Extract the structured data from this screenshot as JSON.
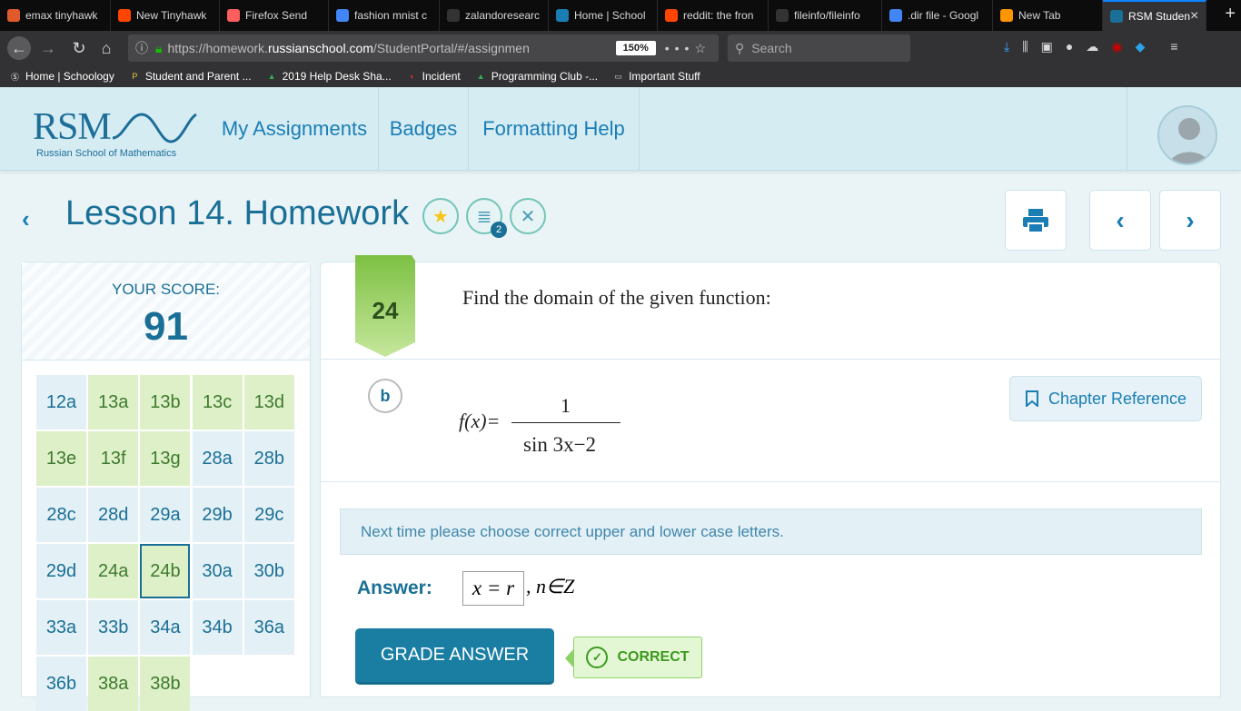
{
  "browser": {
    "tabs": [
      {
        "label": "emax tinyhawk",
        "icon": "bg-icon",
        "color": "#e05a2b"
      },
      {
        "label": "New Tinyhawk",
        "icon": "reddit-icon",
        "color": "#ff4500"
      },
      {
        "label": "Firefox Send",
        "icon": "firefox-send-icon",
        "color": "#ff5e5e"
      },
      {
        "label": "fashion mnist c",
        "icon": "google-icon",
        "color": "#4285f4"
      },
      {
        "label": "zalandoresearc",
        "icon": "github-icon",
        "color": "#333333"
      },
      {
        "label": "Home | School",
        "icon": "schoology-icon",
        "color": "#1a7eb5"
      },
      {
        "label": "reddit: the fron",
        "icon": "reddit-icon",
        "color": "#ff4500"
      },
      {
        "label": "fileinfo/fileinfo",
        "icon": "github-icon",
        "color": "#333333"
      },
      {
        "label": ".dir file - Googl",
        "icon": "google-icon",
        "color": "#4285f4"
      },
      {
        "label": "New Tab",
        "icon": "firefox-icon",
        "color": "#ff9500"
      },
      {
        "label": "RSM Studen",
        "icon": "rsm-icon",
        "color": "#1a6f96",
        "active": true
      }
    ],
    "url_prefix": "https://homework.",
    "url_domain": "russianschool.com",
    "url_path": "/StudentPortal/#/assignmen",
    "zoom": "150%",
    "search_placeholder": "Search",
    "bookmarks": [
      {
        "label": "Home | Schoology",
        "icon": "schoology-icon"
      },
      {
        "label": "Student and Parent ...",
        "icon": "parent-portal-icon"
      },
      {
        "label": "2019 Help Desk Sha...",
        "icon": "google-drive-icon"
      },
      {
        "label": "Incident",
        "icon": "incident-icon"
      },
      {
        "label": "Programming Club -...",
        "icon": "google-drive-icon"
      },
      {
        "label": "Important Stuff",
        "icon": "folder-icon"
      }
    ]
  },
  "site": {
    "logo_text": "RSM",
    "logo_sub": "Russian School of Mathematics",
    "nav": [
      "My Assignments",
      "Badges",
      "Formatting Help"
    ]
  },
  "lesson": {
    "title": "Lesson 14. Homework",
    "badge_count": "2"
  },
  "score": {
    "label": "YOUR SCORE:",
    "value": "91"
  },
  "problems": [
    {
      "label": "12a",
      "status": "blue"
    },
    {
      "label": "13a",
      "status": "green"
    },
    {
      "label": "13b",
      "status": "green"
    },
    {
      "label": "13c",
      "status": "green"
    },
    {
      "label": "13d",
      "status": "green"
    },
    {
      "label": "13e",
      "status": "green"
    },
    {
      "label": "13f",
      "status": "green"
    },
    {
      "label": "13g",
      "status": "green"
    },
    {
      "label": "28a",
      "status": "blue"
    },
    {
      "label": "28b",
      "status": "blue"
    },
    {
      "label": "28c",
      "status": "blue"
    },
    {
      "label": "28d",
      "status": "blue"
    },
    {
      "label": "29a",
      "status": "blue"
    },
    {
      "label": "29b",
      "status": "blue"
    },
    {
      "label": "29c",
      "status": "blue"
    },
    {
      "label": "29d",
      "status": "blue"
    },
    {
      "label": "24a",
      "status": "green"
    },
    {
      "label": "24b",
      "status": "green",
      "selected": true
    },
    {
      "label": "30a",
      "status": "blue"
    },
    {
      "label": "30b",
      "status": "blue"
    },
    {
      "label": "33a",
      "status": "blue"
    },
    {
      "label": "33b",
      "status": "blue"
    },
    {
      "label": "34a",
      "status": "blue"
    },
    {
      "label": "34b",
      "status": "blue"
    },
    {
      "label": "36a",
      "status": "blue"
    },
    {
      "label": "36b",
      "status": "blue"
    },
    {
      "label": "38a",
      "status": "green"
    },
    {
      "label": "38b",
      "status": "green"
    }
  ],
  "question": {
    "number": "24",
    "text": "Find the domain of the given function:",
    "part": "b",
    "function_lhs": "f(x)=",
    "numerator": "1",
    "denominator": "sin 3x−2",
    "chapter_reference": "Chapter Reference",
    "hint": "Next time please choose correct upper and lower case letters.",
    "answer_label": "Answer:",
    "answer_value": "x = r",
    "answer_tail": ", n∈Z",
    "grade_button": "GRADE ANSWER",
    "result": "CORRECT"
  }
}
